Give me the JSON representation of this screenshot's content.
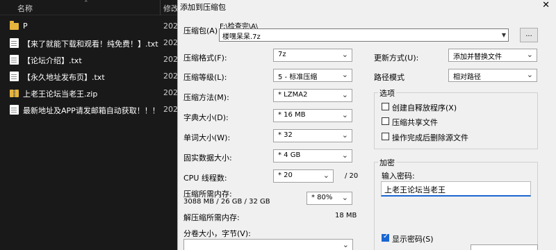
{
  "explorer": {
    "header": {
      "name_label": "名称",
      "sort_glyph": "⌃",
      "modified_label": "修改"
    },
    "rows": [
      {
        "icon": "folder-icon",
        "name": "P",
        "date": "202"
      },
      {
        "icon": "document-icon",
        "name": "【来了就能下载和观看！纯免费！】.txt",
        "date": "202"
      },
      {
        "icon": "document-icon",
        "name": "【论坛介绍】.txt",
        "date": "202"
      },
      {
        "icon": "document-icon",
        "name": "【永久地址发布页】.txt",
        "date": "202"
      },
      {
        "icon": "zip-folder-icon",
        "name": "上老王论坛当老王.zip",
        "date": "202"
      },
      {
        "icon": "document-icon",
        "name": "最新地址及APP请发邮箱自动获取！！！....",
        "date": "202"
      }
    ]
  },
  "dialog": {
    "title": "添加到压缩包",
    "close_glyph": "✕",
    "archive_label": "压缩包(A)",
    "archive_path": "F:\\检查完\\A\\",
    "archive_name": "楼嘿呆呆.7z",
    "browse_label": "...",
    "format_label": "压缩格式(F):",
    "format_value": "7z",
    "level_label": "压缩等级(L):",
    "level_value": "5 - 标准压缩",
    "method_label": "压缩方法(M):",
    "method_value": "* LZMA2",
    "dict_label": "字典大小(D):",
    "dict_value": "* 16 MB",
    "word_label": "单词大小(W):",
    "word_value": "* 32",
    "solid_label": "固实数据大小:",
    "solid_value": "* 4 GB",
    "cpu_label": "CPU 线程数:",
    "cpu_value": "* 20",
    "cpu_total": "/ 20",
    "mem_comp_label": "压缩所需内存:",
    "mem_comp_detail": "3088 MB / 26 GB / 32 GB",
    "mem_percent": "* 80%",
    "mem_decomp_label": "解压缩所需内存:",
    "mem_decomp_value": "18 MB",
    "split_label": "分卷大小，字节(V):",
    "update_label": "更新方式(U):",
    "update_value": "添加并替换文件",
    "path_mode_label": "路径模式",
    "path_mode_value": "相对路径",
    "options_title": "选项",
    "options": [
      {
        "label": "创建自释放程序(X)",
        "checked": false
      },
      {
        "label": "压缩共享文件",
        "checked": false
      },
      {
        "label": "操作完成后删除源文件",
        "checked": false
      }
    ],
    "encryption_title": "加密",
    "password_label": "输入密码:",
    "password_value": "上老王论坛当老王",
    "show_password_label": "显示密码(S)",
    "show_password_checked": true
  }
}
